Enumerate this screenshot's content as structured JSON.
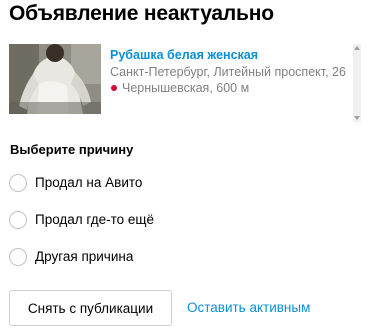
{
  "page": {
    "title": "Объявление неактуально"
  },
  "listing": {
    "title": "Рубашка белая женская",
    "address": "Санкт-Петербург, Литейный проспект, 26",
    "metro": "Чернышевская, 600 м",
    "metro_color": "#d6083b",
    "link_color": "#0a8fd6"
  },
  "reason_section": {
    "label": "Выберите причину",
    "options": [
      {
        "label": "Продал на Авито",
        "selected": false
      },
      {
        "label": "Продал где-то ещё",
        "selected": false
      },
      {
        "label": "Другая причина",
        "selected": false
      }
    ]
  },
  "actions": {
    "unpublish_label": "Снять с публикации",
    "keep_active_label": "Оставить активным"
  },
  "icons": {
    "metro": "metro-dot-icon",
    "scroll_up": "scroll-up-arrow-icon",
    "scroll_down": "scroll-down-arrow-icon"
  }
}
